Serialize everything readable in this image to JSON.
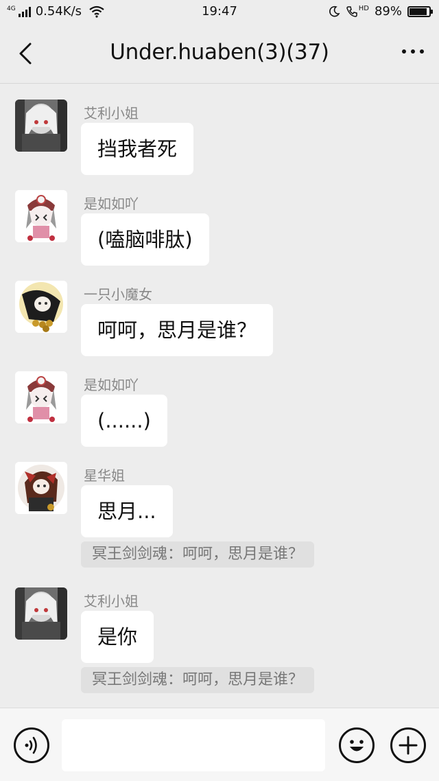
{
  "status_bar": {
    "network_type": "4G",
    "speed": "0.54K/s",
    "time": "19:47",
    "hd_label": "HD",
    "battery": "89%",
    "battery_level": 0.89
  },
  "header": {
    "title": "Under.huaben(3)(37)"
  },
  "messages": [
    {
      "sender": "艾利小姐",
      "text": "挡我者死"
    },
    {
      "sender": "是如如吖",
      "text": "(嗑脑啡肽)"
    },
    {
      "sender": "一只小魔女",
      "text": "呵呵，思月是谁？"
    },
    {
      "sender": "是如如吖",
      "text": "(......)"
    },
    {
      "sender": "星华姐",
      "text": "思月...",
      "quote": "冥王剑剑魂：呵呵，思月是谁？"
    },
    {
      "sender": "艾利小姐",
      "text": "是你",
      "quote": "冥王剑剑魂：呵呵，思月是谁？"
    }
  ],
  "colors": {
    "background": "#ededed",
    "bubble": "#ffffff",
    "quote": "#e0e0e0",
    "sender": "#888888"
  },
  "icons": {
    "back": "chevron-left-icon",
    "more": "more-dots-icon",
    "voice": "voice-icon",
    "emoji": "emoji-icon",
    "add": "plus-icon"
  }
}
